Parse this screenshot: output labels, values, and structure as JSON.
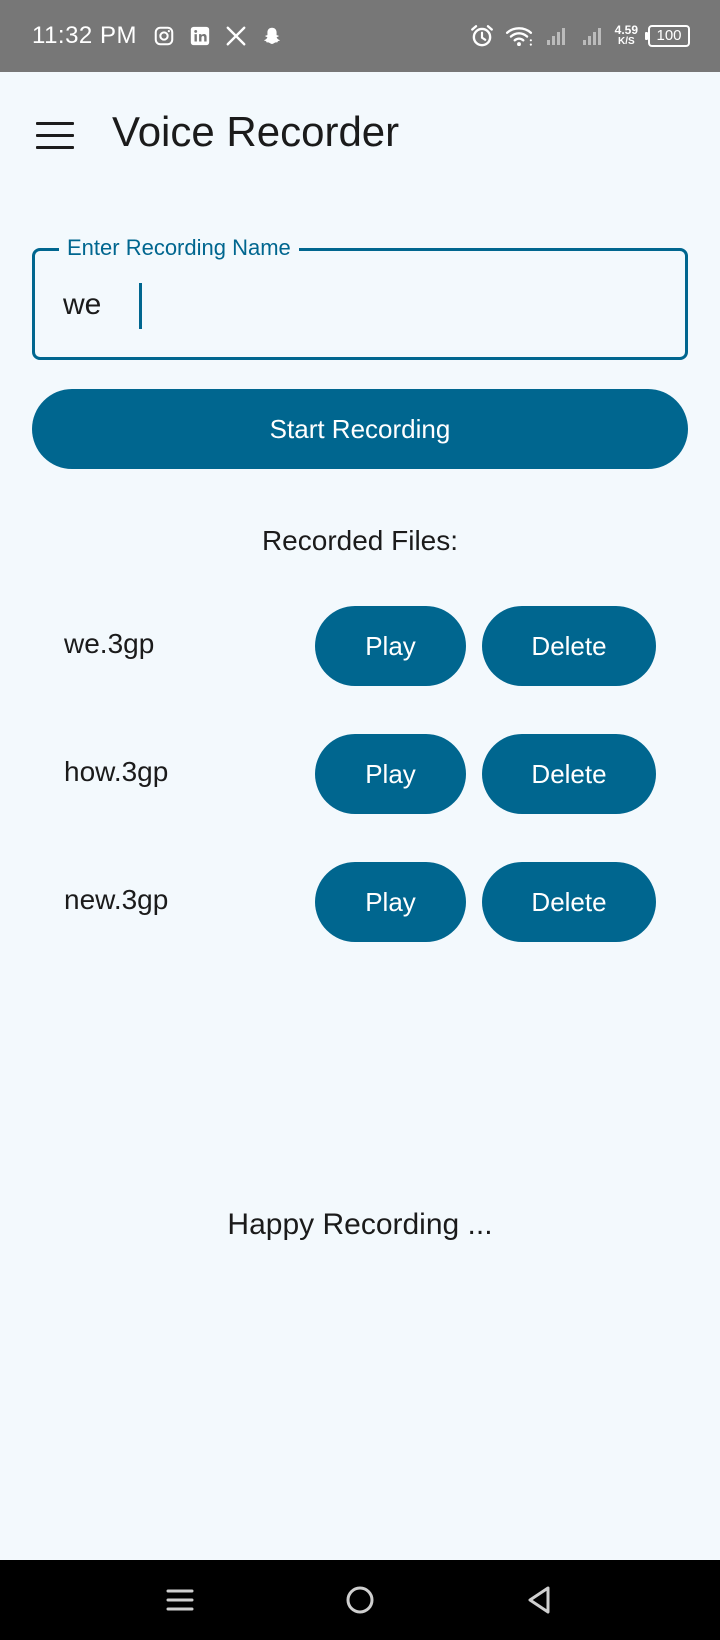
{
  "status_bar": {
    "time": "11:32 PM",
    "net_speed_value": "4.59",
    "net_speed_unit": "K/S",
    "battery": "100",
    "icons": [
      "instagram-icon",
      "linkedin-icon",
      "x-icon",
      "snapchat-icon",
      "alarm-icon",
      "wifi-icon",
      "signal-icon",
      "signal-icon"
    ]
  },
  "app_bar": {
    "title": "Voice Recorder"
  },
  "recording_field": {
    "label": "Enter Recording Name",
    "value": "we"
  },
  "start_button": {
    "label": "Start Recording"
  },
  "files_section": {
    "heading": "Recorded Files:",
    "files": [
      {
        "name": "we.3gp",
        "play_label": "Play",
        "delete_label": "Delete"
      },
      {
        "name": "how.3gp",
        "play_label": "Play",
        "delete_label": "Delete"
      },
      {
        "name": "new.3gp",
        "play_label": "Play",
        "delete_label": "Delete"
      }
    ]
  },
  "footer": {
    "text": "Happy Recording ..."
  },
  "colors": {
    "primary": "#00668f",
    "background": "#f3f9fd",
    "status_bar": "#777777"
  }
}
